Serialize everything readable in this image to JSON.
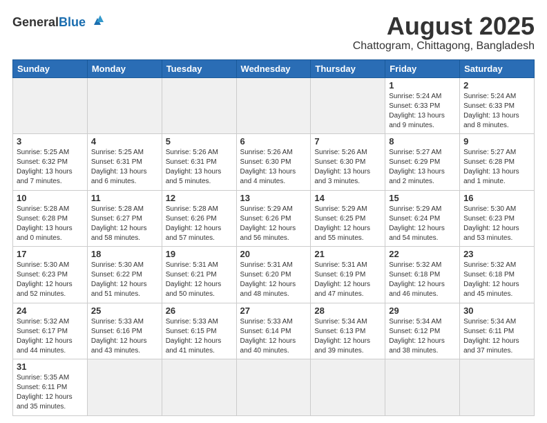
{
  "header": {
    "logo_general": "General",
    "logo_blue": "Blue",
    "main_title": "August 2025",
    "sub_title": "Chattogram, Chittagong, Bangladesh"
  },
  "days_of_week": [
    "Sunday",
    "Monday",
    "Tuesday",
    "Wednesday",
    "Thursday",
    "Friday",
    "Saturday"
  ],
  "weeks": [
    [
      {
        "day": "",
        "info": ""
      },
      {
        "day": "",
        "info": ""
      },
      {
        "day": "",
        "info": ""
      },
      {
        "day": "",
        "info": ""
      },
      {
        "day": "",
        "info": ""
      },
      {
        "day": "1",
        "info": "Sunrise: 5:24 AM\nSunset: 6:33 PM\nDaylight: 13 hours and 9 minutes."
      },
      {
        "day": "2",
        "info": "Sunrise: 5:24 AM\nSunset: 6:33 PM\nDaylight: 13 hours and 8 minutes."
      }
    ],
    [
      {
        "day": "3",
        "info": "Sunrise: 5:25 AM\nSunset: 6:32 PM\nDaylight: 13 hours and 7 minutes."
      },
      {
        "day": "4",
        "info": "Sunrise: 5:25 AM\nSunset: 6:31 PM\nDaylight: 13 hours and 6 minutes."
      },
      {
        "day": "5",
        "info": "Sunrise: 5:26 AM\nSunset: 6:31 PM\nDaylight: 13 hours and 5 minutes."
      },
      {
        "day": "6",
        "info": "Sunrise: 5:26 AM\nSunset: 6:30 PM\nDaylight: 13 hours and 4 minutes."
      },
      {
        "day": "7",
        "info": "Sunrise: 5:26 AM\nSunset: 6:30 PM\nDaylight: 13 hours and 3 minutes."
      },
      {
        "day": "8",
        "info": "Sunrise: 5:27 AM\nSunset: 6:29 PM\nDaylight: 13 hours and 2 minutes."
      },
      {
        "day": "9",
        "info": "Sunrise: 5:27 AM\nSunset: 6:28 PM\nDaylight: 13 hours and 1 minute."
      }
    ],
    [
      {
        "day": "10",
        "info": "Sunrise: 5:28 AM\nSunset: 6:28 PM\nDaylight: 13 hours and 0 minutes."
      },
      {
        "day": "11",
        "info": "Sunrise: 5:28 AM\nSunset: 6:27 PM\nDaylight: 12 hours and 58 minutes."
      },
      {
        "day": "12",
        "info": "Sunrise: 5:28 AM\nSunset: 6:26 PM\nDaylight: 12 hours and 57 minutes."
      },
      {
        "day": "13",
        "info": "Sunrise: 5:29 AM\nSunset: 6:26 PM\nDaylight: 12 hours and 56 minutes."
      },
      {
        "day": "14",
        "info": "Sunrise: 5:29 AM\nSunset: 6:25 PM\nDaylight: 12 hours and 55 minutes."
      },
      {
        "day": "15",
        "info": "Sunrise: 5:29 AM\nSunset: 6:24 PM\nDaylight: 12 hours and 54 minutes."
      },
      {
        "day": "16",
        "info": "Sunrise: 5:30 AM\nSunset: 6:23 PM\nDaylight: 12 hours and 53 minutes."
      }
    ],
    [
      {
        "day": "17",
        "info": "Sunrise: 5:30 AM\nSunset: 6:23 PM\nDaylight: 12 hours and 52 minutes."
      },
      {
        "day": "18",
        "info": "Sunrise: 5:30 AM\nSunset: 6:22 PM\nDaylight: 12 hours and 51 minutes."
      },
      {
        "day": "19",
        "info": "Sunrise: 5:31 AM\nSunset: 6:21 PM\nDaylight: 12 hours and 50 minutes."
      },
      {
        "day": "20",
        "info": "Sunrise: 5:31 AM\nSunset: 6:20 PM\nDaylight: 12 hours and 48 minutes."
      },
      {
        "day": "21",
        "info": "Sunrise: 5:31 AM\nSunset: 6:19 PM\nDaylight: 12 hours and 47 minutes."
      },
      {
        "day": "22",
        "info": "Sunrise: 5:32 AM\nSunset: 6:18 PM\nDaylight: 12 hours and 46 minutes."
      },
      {
        "day": "23",
        "info": "Sunrise: 5:32 AM\nSunset: 6:18 PM\nDaylight: 12 hours and 45 minutes."
      }
    ],
    [
      {
        "day": "24",
        "info": "Sunrise: 5:32 AM\nSunset: 6:17 PM\nDaylight: 12 hours and 44 minutes."
      },
      {
        "day": "25",
        "info": "Sunrise: 5:33 AM\nSunset: 6:16 PM\nDaylight: 12 hours and 43 minutes."
      },
      {
        "day": "26",
        "info": "Sunrise: 5:33 AM\nSunset: 6:15 PM\nDaylight: 12 hours and 41 minutes."
      },
      {
        "day": "27",
        "info": "Sunrise: 5:33 AM\nSunset: 6:14 PM\nDaylight: 12 hours and 40 minutes."
      },
      {
        "day": "28",
        "info": "Sunrise: 5:34 AM\nSunset: 6:13 PM\nDaylight: 12 hours and 39 minutes."
      },
      {
        "day": "29",
        "info": "Sunrise: 5:34 AM\nSunset: 6:12 PM\nDaylight: 12 hours and 38 minutes."
      },
      {
        "day": "30",
        "info": "Sunrise: 5:34 AM\nSunset: 6:11 PM\nDaylight: 12 hours and 37 minutes."
      }
    ],
    [
      {
        "day": "31",
        "info": "Sunrise: 5:35 AM\nSunset: 6:11 PM\nDaylight: 12 hours and 35 minutes."
      },
      {
        "day": "",
        "info": ""
      },
      {
        "day": "",
        "info": ""
      },
      {
        "day": "",
        "info": ""
      },
      {
        "day": "",
        "info": ""
      },
      {
        "day": "",
        "info": ""
      },
      {
        "day": "",
        "info": ""
      }
    ]
  ]
}
